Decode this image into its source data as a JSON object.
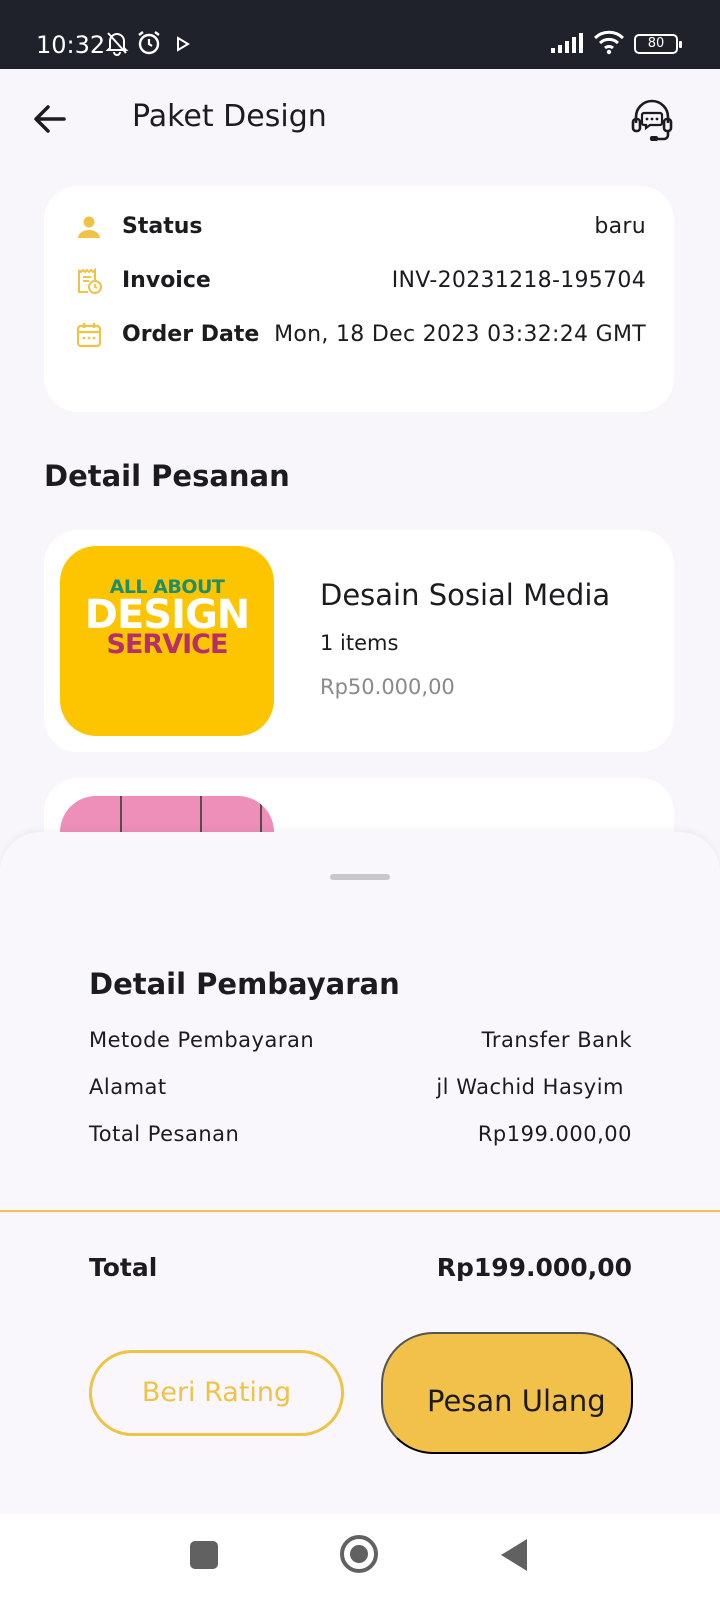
{
  "status_bar": {
    "time": "10:32",
    "battery": "80"
  },
  "header": {
    "title": "Paket Design"
  },
  "order_info": {
    "status": {
      "label": "Status",
      "value": "baru"
    },
    "invoice": {
      "label": "Invoice",
      "value": "INV-20231218-195704"
    },
    "order_date": {
      "label": "Order Date",
      "value": "Mon, 18 Dec 2023 03:32:24 GMT"
    }
  },
  "order_detail": {
    "section_title": "Detail Pesanan",
    "items": [
      {
        "name": "Desain Sosial Media",
        "quantity": "1 items",
        "price": "Rp50.000,00",
        "image_text": [
          "ALL ABOUT",
          "DESIGN",
          "SERVICE"
        ]
      }
    ]
  },
  "payment": {
    "title": "Detail Pembayaran",
    "method": {
      "label": "Metode Pembayaran",
      "value": "Transfer Bank"
    },
    "address": {
      "label": "Alamat",
      "value": "jl Wachid Hasyim"
    },
    "order_total": {
      "label": "Total Pesanan",
      "value": "Rp199.000,00"
    },
    "total": {
      "label": "Total",
      "value": "Rp199.000,00"
    }
  },
  "actions": {
    "rating_label": "Beri Rating",
    "reorder_label": "Pesan Ulang"
  },
  "colors": {
    "accent": "#efc346",
    "status_bar": "#1f212b",
    "thumb_bg": "#fdc400"
  },
  "icons": {
    "back": "arrow-left-icon",
    "support": "headset-chat-icon",
    "status": "person-icon",
    "invoice": "receipt-clock-icon",
    "order_date": "calendar-icon"
  }
}
